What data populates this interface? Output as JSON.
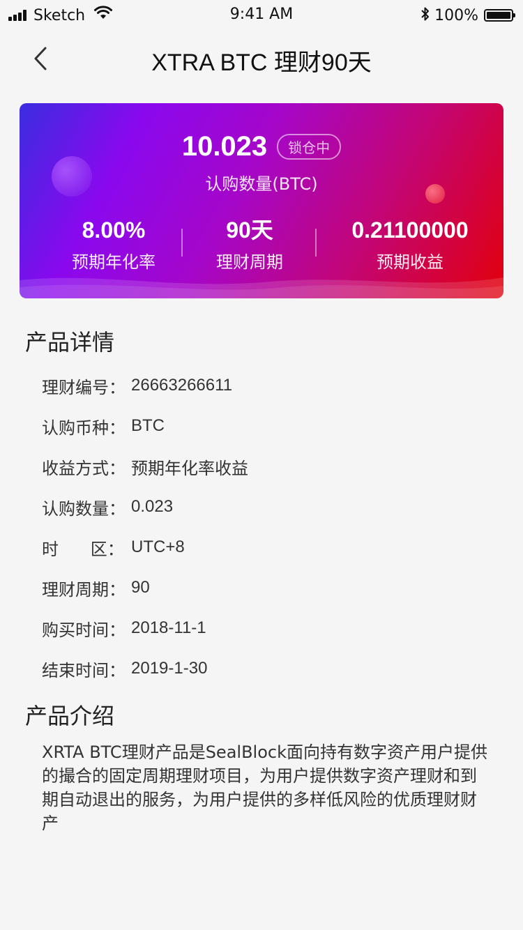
{
  "status_bar": {
    "carrier": "Sketch",
    "time": "9:41 AM",
    "battery": "100%"
  },
  "nav": {
    "title": "XTRA BTC 理财90天",
    "back_icon": "chevron-left-icon"
  },
  "card": {
    "amount": "10.023",
    "badge": "锁仓中",
    "amount_label": "认购数量(BTC)",
    "stats": [
      {
        "value": "8.00%",
        "label": "预期年化率"
      },
      {
        "value": "90天",
        "label": "理财周期"
      },
      {
        "value": "0.21100000",
        "label": "预期收益"
      }
    ],
    "gradient_start": "#3b2de0",
    "gradient_end": "#e2000a"
  },
  "details": {
    "title": "产品详情",
    "rows": [
      {
        "label": "理财编号：",
        "value": "26663266611"
      },
      {
        "label": "认购币种：",
        "value": "BTC"
      },
      {
        "label": "收益方式：",
        "value": "预期年化率收益"
      },
      {
        "label": "认购数量：",
        "value": "0.023"
      },
      {
        "label": "时      区：",
        "value": "UTC+8"
      },
      {
        "label": "理财周期：",
        "value": "90"
      },
      {
        "label": "购买时间：",
        "value": "2018-11-1"
      },
      {
        "label": "结束时间：",
        "value": "2019-1-30"
      }
    ]
  },
  "intro": {
    "title": "产品介绍",
    "text": "XRTA BTC理财产品是SealBlock面向持有数字资产用户提供的撮合的固定周期理财项目，为用户提供数字资产理财和到期自动退出的服务，为用户提供的多样低风险的优质理财财产"
  }
}
